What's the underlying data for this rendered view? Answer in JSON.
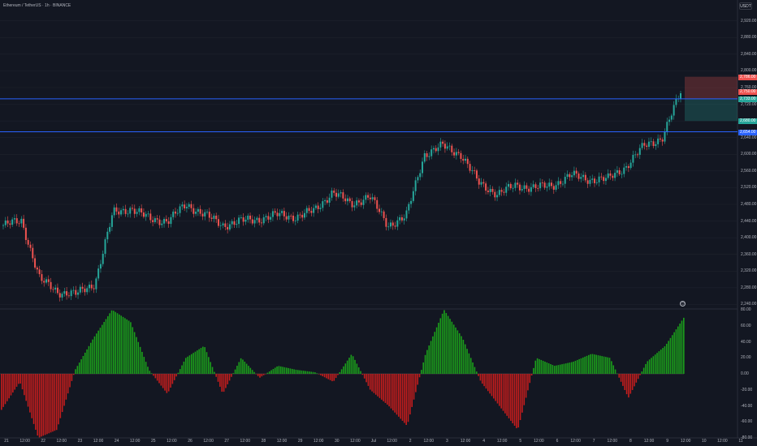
{
  "header": {
    "title": "Ethereum / TetherUS · 1h · BINANCE",
    "quote_badge": "USDT"
  },
  "price_axis": [
    "2,920.00",
    "2,880.00",
    "2,840.00",
    "2,800.00",
    "2,760.00",
    "2,720.00",
    "2,680.00",
    "2,640.00",
    "2,600.00",
    "2,560.00",
    "2,520.00",
    "2,480.00",
    "2,440.00",
    "2,400.00",
    "2,360.00",
    "2,320.00",
    "2,280.00",
    "2,240.00"
  ],
  "indicator_axis": [
    "80.00",
    "60.00",
    "40.00",
    "20.00",
    "0.00",
    "-20.00",
    "-40.00",
    "-60.00",
    "-80.00"
  ],
  "time_axis": [
    "21",
    "12:00",
    "22",
    "12:00",
    "23",
    "12:00",
    "24",
    "12:00",
    "25",
    "12:00",
    "26",
    "12:00",
    "27",
    "12:00",
    "28",
    "12:00",
    "29",
    "12:00",
    "30",
    "12:00",
    "Jul",
    "12:00",
    "2",
    "12:00",
    "3",
    "12:00",
    "4",
    "12:00",
    "5",
    "12:00",
    "6",
    "12:00",
    "7",
    "12:00",
    "8",
    "12:00",
    "9",
    "12:00",
    "10",
    "12:00",
    "11"
  ],
  "horizontal_lines": [
    2733,
    2654
  ],
  "position_tool": {
    "entry": 2733,
    "stop": 2786,
    "target": 2680
  },
  "alert_icon": "alert-clock-icon",
  "colors": {
    "background": "#131722",
    "up": "#26a69a",
    "down": "#ef5350",
    "hline": "#2962ff",
    "osc_up": "#1b9e1b",
    "osc_down": "#c41d1d"
  },
  "chart_data": [
    {
      "type": "line",
      "title": "",
      "x": [
        "21 00:00",
        "21 12:00",
        "22 00:00",
        "22 12:00",
        "23 00:00",
        "23 12:00",
        "24 00:00",
        "24 12:00",
        "25 00:00",
        "25 12:00",
        "26 00:00",
        "26 12:00",
        "27 00:00",
        "27 12:00",
        "28 00:00",
        "28 12:00",
        "29 00:00",
        "29 12:00",
        "30 00:00",
        "30 12:00",
        "Jul 1 00:00",
        "Jul 1 12:00",
        "2 00:00",
        "2 12:00",
        "3 00:00",
        "3 12:00",
        "4 00:00",
        "4 12:00",
        "5 00:00",
        "5 12:00",
        "6 00:00",
        "6 12:00",
        "7 00:00",
        "7 12:00",
        "8 00:00",
        "8 12:00",
        "9 00:00",
        "9 12:00"
      ],
      "series": [
        {
          "values": [
            2430,
            2440,
            2300,
            2270,
            2265,
            2290,
            2460,
            2470,
            2445,
            2440,
            2480,
            2455,
            2430,
            2440,
            2445,
            2455,
            2450,
            2465,
            2510,
            2480,
            2500,
            2430,
            2450,
            2600,
            2620,
            2600,
            2530,
            2505,
            2525,
            2520,
            2525,
            2550,
            2540,
            2540,
            2570,
            2620,
            2640,
            2750
          ]
        }
      ],
      "ylim": [
        2235,
        2935
      ],
      "xlabel": "",
      "ylabel": "USDT"
    },
    {
      "type": "bar",
      "title": "",
      "categories": [
        "21",
        "21.5",
        "22",
        "22.5",
        "23",
        "23.5",
        "24",
        "24.5",
        "25",
        "25.5",
        "26",
        "26.5",
        "27",
        "27.5",
        "28",
        "28.5",
        "29",
        "29.5",
        "30",
        "30.5",
        "Jul 1",
        "1.5",
        "2",
        "2.5",
        "3",
        "3.5",
        "4",
        "4.5",
        "5",
        "5.5",
        "6",
        "6.5",
        "7",
        "7.5",
        "8",
        "8.5",
        "9",
        "9.5"
      ],
      "values": [
        -45,
        -10,
        -80,
        -70,
        5,
        45,
        80,
        65,
        5,
        -25,
        20,
        35,
        -25,
        20,
        -5,
        10,
        5,
        2,
        -10,
        25,
        -20,
        -40,
        -65,
        25,
        80,
        45,
        -10,
        -40,
        -70,
        20,
        10,
        15,
        25,
        20,
        -30,
        15,
        35,
        70
      ],
      "ylim": [
        -85,
        85
      ],
      "colors": {
        "positive": "#1b9e1b",
        "negative": "#c41d1d"
      }
    }
  ]
}
